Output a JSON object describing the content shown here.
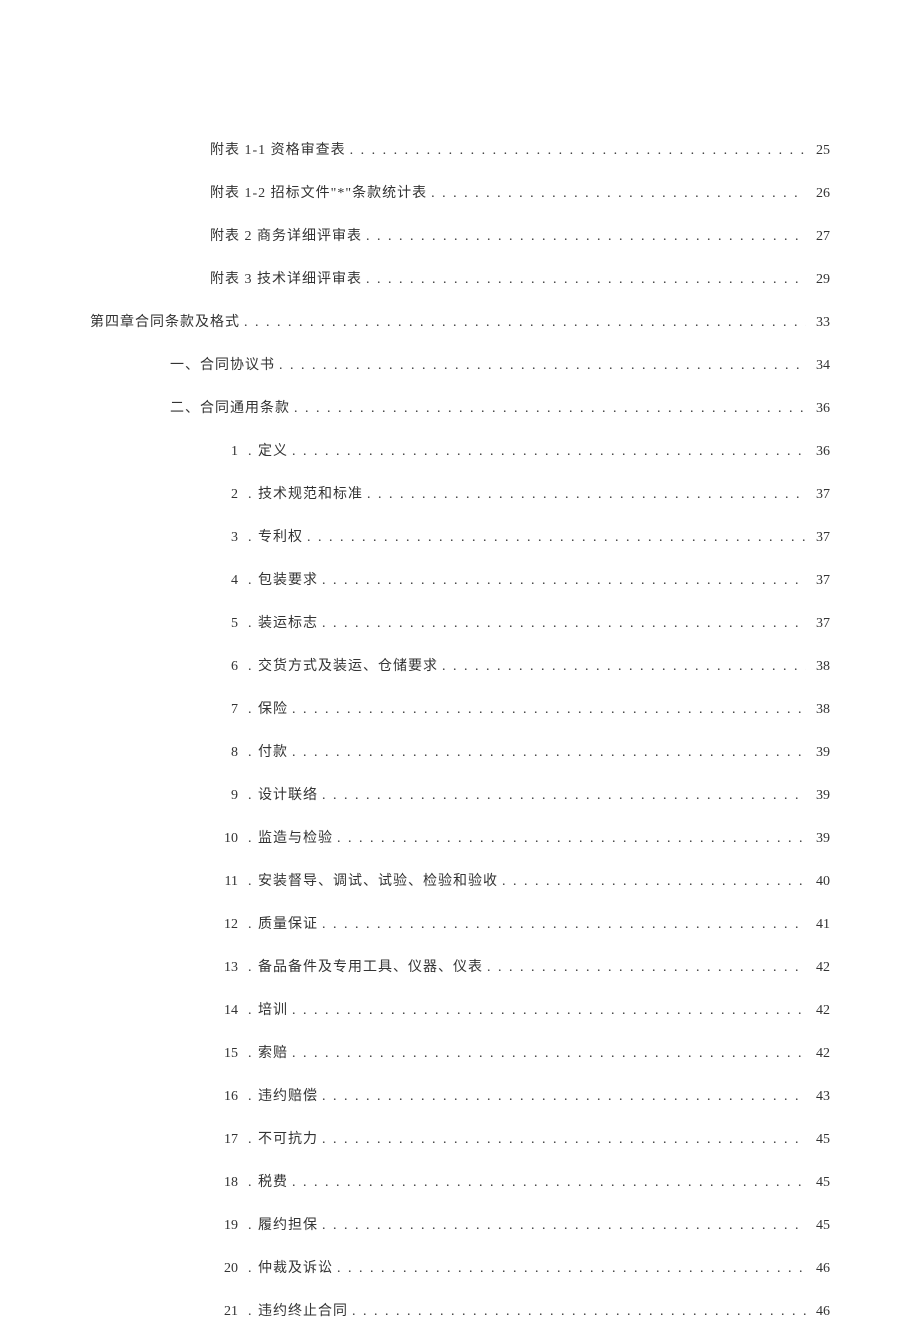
{
  "toc": [
    {
      "indent": 2,
      "num": "",
      "sep": "",
      "label": "附表 1-1 资格审查表",
      "page": "25"
    },
    {
      "indent": 2,
      "num": "",
      "sep": "",
      "label": "附表 1-2 招标文件\"*\"条款统计表",
      "page": "26"
    },
    {
      "indent": 2,
      "num": "",
      "sep": "",
      "label": "附表 2 商务详细评审表",
      "page": "27"
    },
    {
      "indent": 2,
      "num": "",
      "sep": "",
      "label": "附表 3 技术详细评审表",
      "page": "29"
    },
    {
      "indent": 0,
      "num": "",
      "sep": "",
      "label": "第四章合同条款及格式",
      "page": "33"
    },
    {
      "indent": 1,
      "num": "",
      "sep": "",
      "label": "一、合同协议书",
      "page": "34"
    },
    {
      "indent": 1,
      "num": "",
      "sep": "",
      "label": "二、合同通用条款",
      "page": "36"
    },
    {
      "indent": 3,
      "num": "1",
      "sep": ". ",
      "label": "定义",
      "page": "36"
    },
    {
      "indent": 3,
      "num": "2",
      "sep": ".",
      "label": "技术规范和标准",
      "page": "37"
    },
    {
      "indent": 3,
      "num": "3",
      "sep": ".",
      "label": "专利权",
      "page": "37"
    },
    {
      "indent": 3,
      "num": "4",
      "sep": ".",
      "label": "包装要求",
      "page": "37"
    },
    {
      "indent": 3,
      "num": "5",
      "sep": ".",
      "label": "装运标志",
      "page": "37"
    },
    {
      "indent": 3,
      "num": "6",
      "sep": ".",
      "label": "交货方式及装运、仓储要求",
      "page": "38"
    },
    {
      "indent": 3,
      "num": "7",
      "sep": ".",
      "label": "保险",
      "page": "38"
    },
    {
      "indent": 3,
      "num": "8",
      "sep": ". ",
      "label": "付款",
      "page": "39"
    },
    {
      "indent": 3,
      "num": "9",
      "sep": ".",
      "label": "设计联络",
      "page": "39"
    },
    {
      "indent": 3,
      "num": "10",
      "sep": ".",
      "label": "监造与检验",
      "page": "39"
    },
    {
      "indent": 3,
      "num": "11",
      "sep": ".",
      "label": "安装督导、调试、试验、检验和验收",
      "page": "40"
    },
    {
      "indent": 3,
      "num": "12",
      "sep": ".",
      "label": "质量保证",
      "page": "41"
    },
    {
      "indent": 3,
      "num": "13",
      "sep": ".",
      "label": "备品备件及专用工具、仪器、仪表",
      "page": "42"
    },
    {
      "indent": 3,
      "num": "14",
      "sep": ".",
      "label": "培训",
      "page": "42"
    },
    {
      "indent": 3,
      "num": "15",
      "sep": ". ",
      "label": "索赔",
      "page": "42"
    },
    {
      "indent": 3,
      "num": "16",
      "sep": ".",
      "label": "违约赔偿",
      "page": "43"
    },
    {
      "indent": 3,
      "num": "17",
      "sep": ".",
      "label": "不可抗力",
      "page": "45"
    },
    {
      "indent": 3,
      "num": "18",
      "sep": ". ",
      "label": "税费",
      "page": "45"
    },
    {
      "indent": 3,
      "num": "19",
      "sep": ".",
      "label": "履约担保",
      "page": "45"
    },
    {
      "indent": 3,
      "num": "20",
      "sep": ".",
      "label": "仲裁及诉讼",
      "page": "46"
    },
    {
      "indent": 3,
      "num": "21",
      "sep": ".",
      "label": "违约终止合同",
      "page": "46"
    }
  ]
}
